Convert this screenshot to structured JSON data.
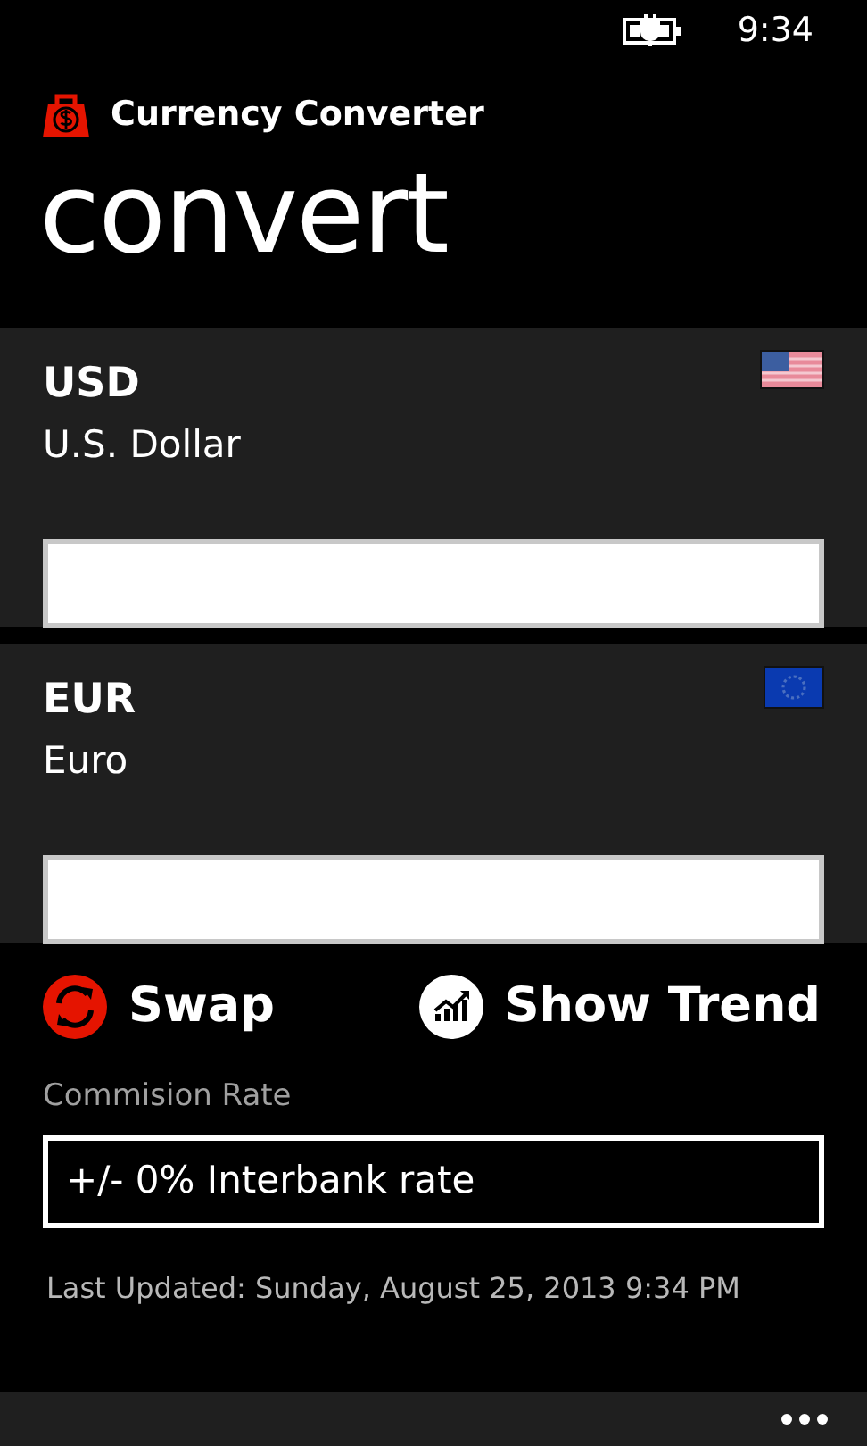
{
  "status_bar": {
    "time": "9:34"
  },
  "app": {
    "title": "Currency Converter"
  },
  "page_title": "convert",
  "currencies": [
    {
      "code": "USD",
      "name": "U.S. Dollar",
      "kind": "us"
    },
    {
      "code": "EUR",
      "name": "Euro",
      "kind": "eu"
    }
  ],
  "actions": [
    {
      "label": "Swap",
      "kind": "swap"
    },
    {
      "label": "Show Trend",
      "kind": "trend"
    }
  ],
  "commission": {
    "label": "Commision Rate",
    "value": "+/- 0% Interbank rate"
  },
  "last_updated": "Last Updated: Sunday, August 25, 2013 9:34 PM"
}
